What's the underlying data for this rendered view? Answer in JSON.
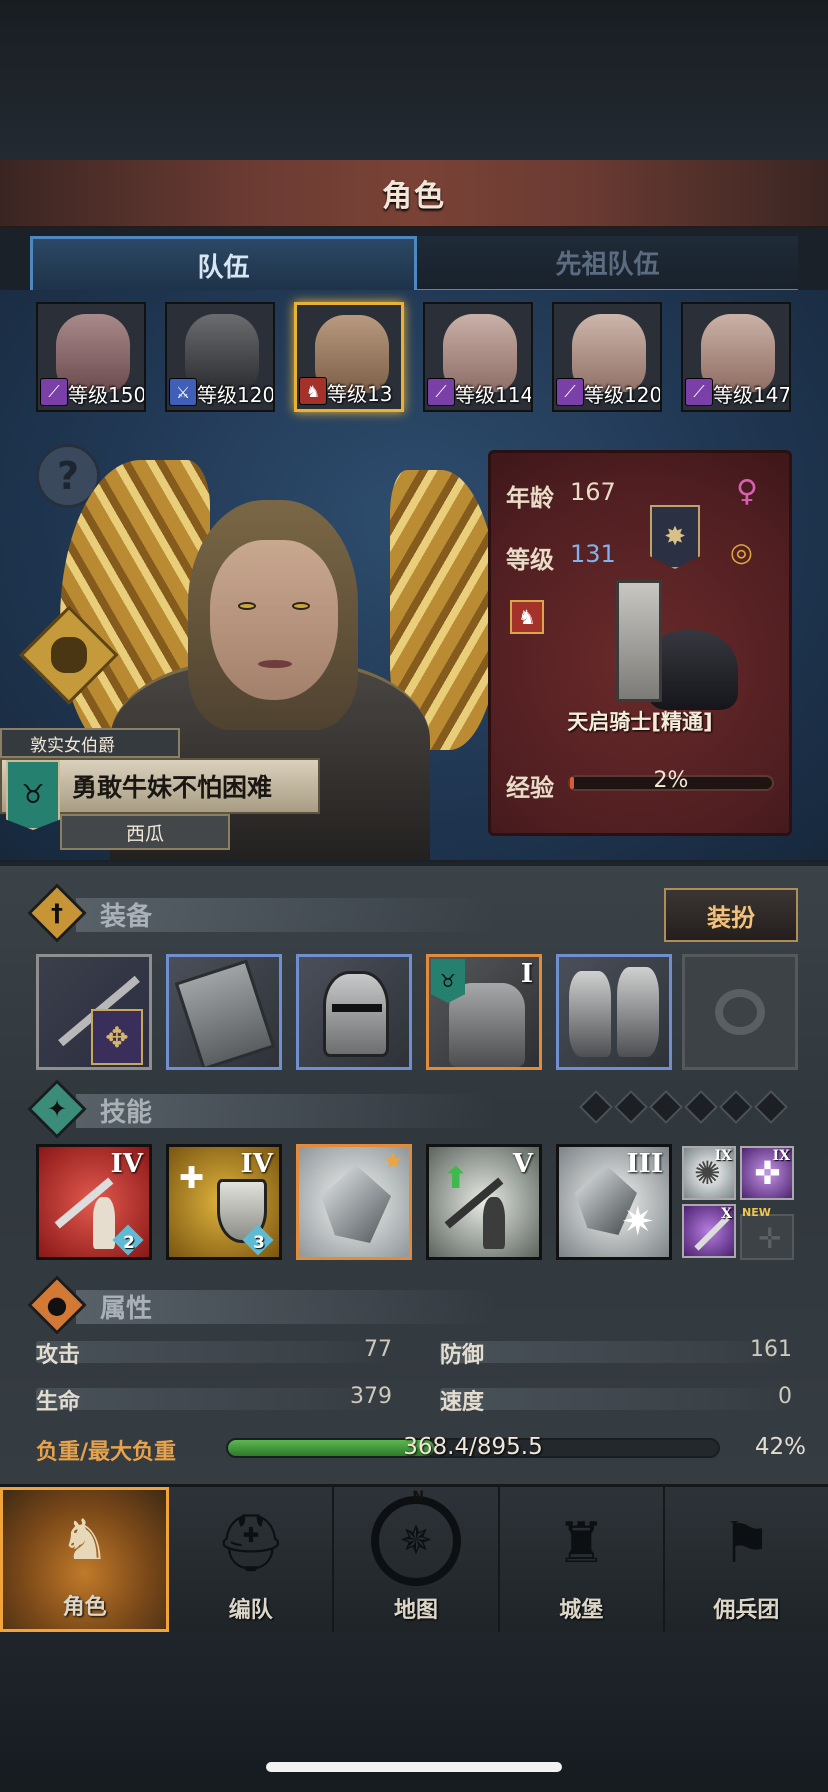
{
  "title": "角色",
  "tabs": [
    {
      "label": "队伍",
      "active": true
    },
    {
      "label": "先祖队伍",
      "active": false
    }
  ],
  "roster": [
    {
      "level_text": "等级150",
      "class_icon": "staff-icon",
      "badge_color": "#7b3fa8"
    },
    {
      "level_text": "等级120",
      "class_icon": "sword-icon",
      "badge_color": "#3f5fb8"
    },
    {
      "level_text": "等级13",
      "class_icon": "horse-icon",
      "badge_color": "#a4322a",
      "selected": true
    },
    {
      "level_text": "等级114",
      "class_icon": "staff-icon",
      "badge_color": "#7b3fa8"
    },
    {
      "level_text": "等级120",
      "class_icon": "staff-icon",
      "badge_color": "#7b3fa8"
    },
    {
      "level_text": "等级147",
      "class_icon": "staff-icon",
      "badge_color": "#7b3fa8"
    }
  ],
  "hero": {
    "title": "敦实女伯爵",
    "name": "勇敢牛妹不怕困难",
    "owner": "西瓜"
  },
  "stats_card": {
    "age_label": "年龄",
    "age": "167",
    "level_label": "等级",
    "level": "131",
    "class_name": "天启骑士[精通]",
    "exp_label": "经验",
    "exp_percent": "2%",
    "exp_fraction": 0.02
  },
  "equipment": {
    "title": "装备",
    "dress_button": "装扮",
    "slots": [
      {
        "name": "banner-lance",
        "rarity": "gray"
      },
      {
        "name": "tower-shield",
        "rarity": "blue"
      },
      {
        "name": "great-helm",
        "rarity": "blue"
      },
      {
        "name": "plate-armor",
        "rarity": "orange",
        "roman": "I"
      },
      {
        "name": "plate-boots",
        "rarity": "blue"
      },
      {
        "name": "ring",
        "rarity": "empty"
      }
    ]
  },
  "skills": {
    "title": "技能",
    "slots": [
      {
        "name": "sword-strike",
        "roman": "IV",
        "count": "2",
        "color": "#b3262a"
      },
      {
        "name": "holy-shield",
        "roman": "IV",
        "count": "3",
        "color": "#b48a1e"
      },
      {
        "name": "crystal-charge",
        "roman": "",
        "count": "",
        "color": "#c9cfd2"
      },
      {
        "name": "sword-buff",
        "roman": "V",
        "count": "",
        "color": "#5f6b62"
      },
      {
        "name": "crystal-burst",
        "roman": "III",
        "count": "",
        "color": "#9aa2a8"
      }
    ],
    "small": [
      {
        "name": "burst",
        "roman": "IX"
      },
      {
        "name": "cross-star",
        "roman": "IX"
      },
      {
        "name": "staff",
        "roman": "X"
      },
      {
        "name": "empty-cross",
        "roman": ""
      }
    ],
    "new_label": "NEW"
  },
  "attributes": {
    "title": "属性",
    "attack_label": "攻击",
    "attack": "77",
    "defense_label": "防御",
    "defense": "161",
    "hp_label": "生命",
    "hp": "379",
    "speed_label": "速度",
    "speed": "0",
    "load_label": "负重/最大负重",
    "load": "368.4/895.5",
    "load_percent": "42%",
    "load_fraction": 0.42
  },
  "nav": [
    {
      "label": "角色",
      "icon": "knight-icon",
      "active": true
    },
    {
      "label": "编队",
      "icon": "helmet-icon"
    },
    {
      "label": "地图",
      "icon": "compass-icon"
    },
    {
      "label": "城堡",
      "icon": "castle-icon"
    },
    {
      "label": "佣兵团",
      "icon": "mercenary-icon"
    }
  ],
  "compass_letter": "N",
  "colors": {
    "accent_gold": "#e9b235",
    "level_blue": "#7fb2ee",
    "gender_pink": "#d85fb4",
    "load_green": "#4caf43"
  }
}
